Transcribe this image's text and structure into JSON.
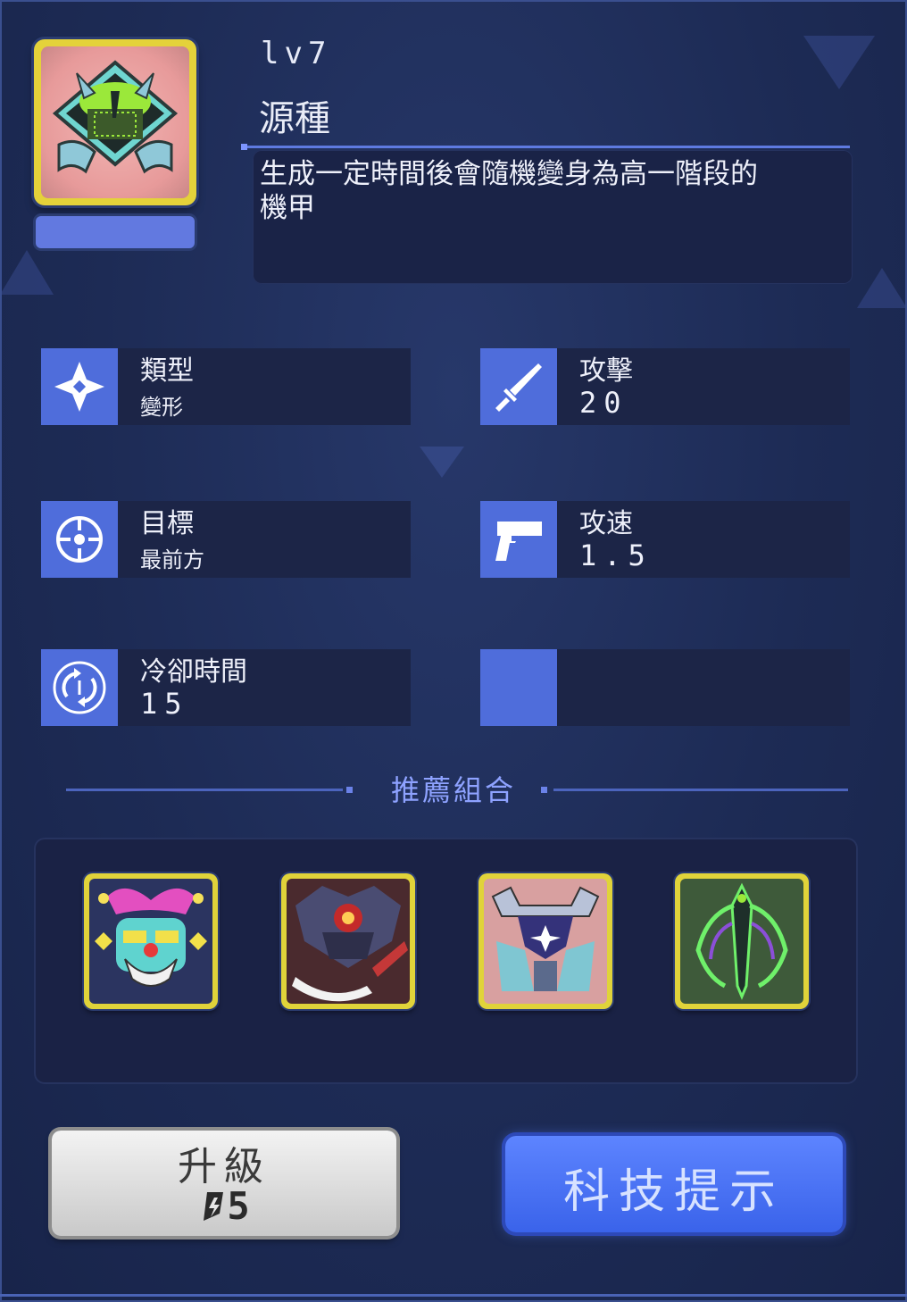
{
  "unit": {
    "level": "lv7",
    "name": "源種",
    "description": "生成一定時間後會隨機變身為高一階段的機甲"
  },
  "stats": {
    "type_label": "類型",
    "type_value": "變形",
    "attack_label": "攻擊",
    "attack_value": "20",
    "target_label": "目標",
    "target_value": "最前方",
    "attack_speed_label": "攻速",
    "attack_speed_value": "1.5",
    "cooldown_label": "冷卻時間",
    "cooldown_value": "15"
  },
  "recommended": {
    "title": "推薦組合",
    "cards": [
      "jester-mech-icon",
      "dark-sentinel-icon",
      "horned-knight-icon",
      "green-mantis-icon"
    ]
  },
  "buttons": {
    "upgrade_label": "升級",
    "upgrade_cost": "5",
    "tech_hint_label": "科技提示"
  },
  "colors": {
    "accent": "#4f6ddb",
    "card_frame": "#e0d33a",
    "tech_button": "#4a72f5"
  }
}
